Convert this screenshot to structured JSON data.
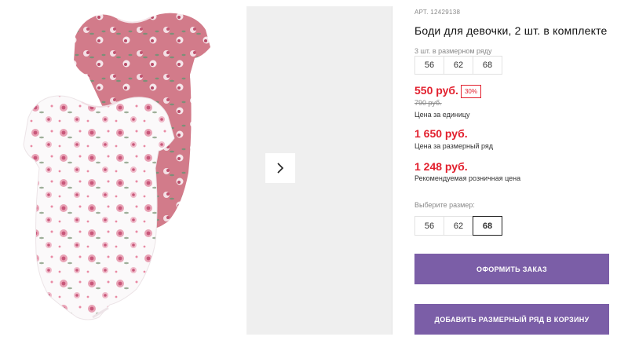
{
  "product": {
    "sku": "АРТ. 12429138",
    "title": "Боди для девочки, 2 шт. в комплекте",
    "series_label": "3 шт. в размерном ряду",
    "series_sizes": [
      "56",
      "62",
      "68"
    ],
    "price_unit": "550 руб.",
    "discount": "30%",
    "old_price": "790 руб.",
    "caption_unit": "Цена за единицу",
    "price_series": "1 650 руб.",
    "caption_series": "Цена за размерный ряд",
    "price_rrp": "1 248 руб.",
    "caption_rrp": "Рекомендуемая розничная цена",
    "choose_size_label": "Выберите размер:",
    "size_options": [
      "56",
      "62",
      "68"
    ],
    "selected_size": "68"
  },
  "actions": {
    "order_label": "ОФОРМИТЬ ЗАКАЗ",
    "add_series_label": "ДОБАВИТЬ РАЗМЕРНЫЙ РЯД В КОРЗИНУ"
  },
  "gallery": {
    "next_icon": "chevron-right-icon",
    "pink_color": "#d27b8a",
    "white_color": "#fbf9fa"
  },
  "colors": {
    "price_red": "#e2202e",
    "button_purple": "#7b5ea7"
  }
}
